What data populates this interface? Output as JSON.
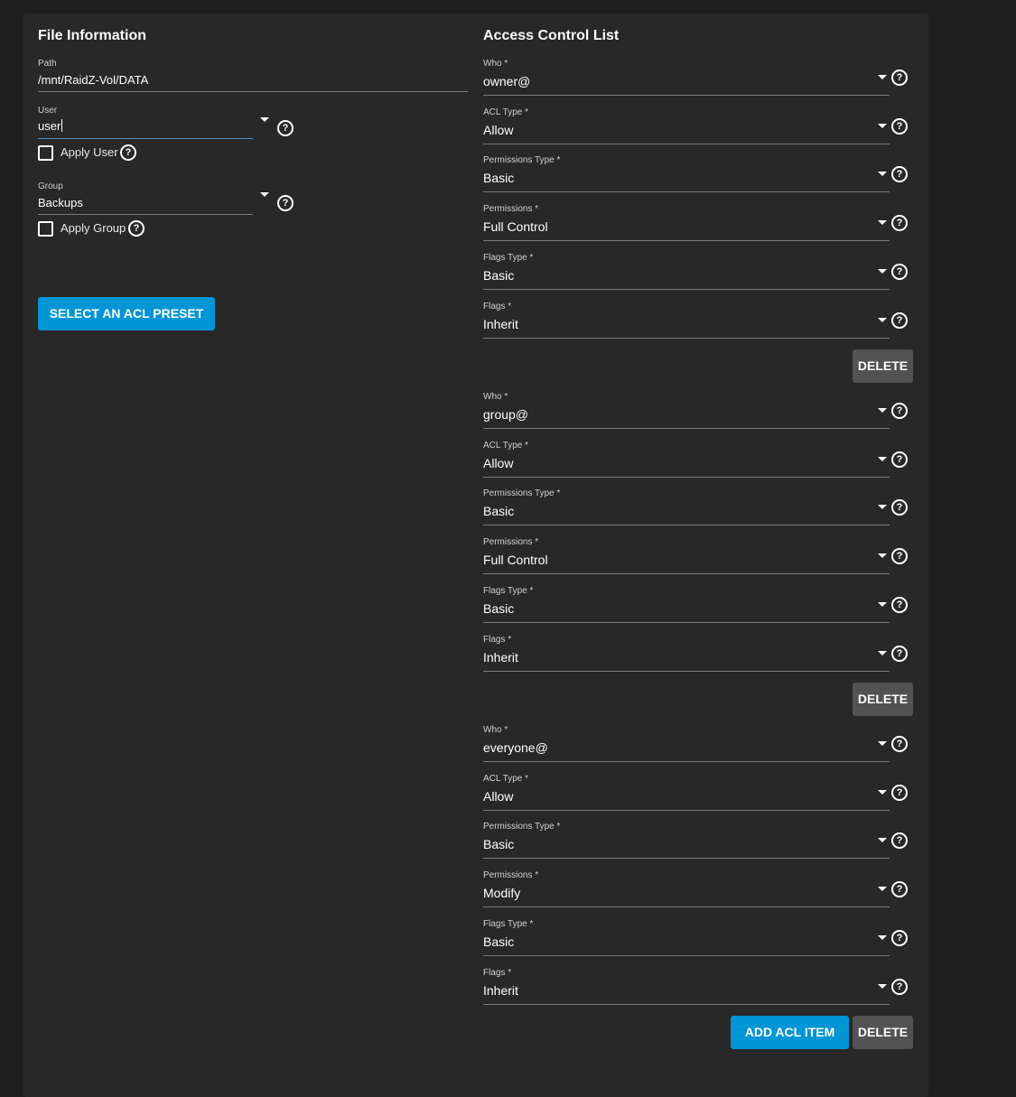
{
  "file_info": {
    "title": "File Information",
    "path_label": "Path",
    "path_value": "/mnt/RaidZ-Vol/DATA",
    "user_label": "User",
    "user_value": "user",
    "apply_user_label": "Apply User",
    "group_label": "Group",
    "group_value": "Backups",
    "apply_group_label": "Apply Group",
    "preset_button": "SELECT AN ACL PRESET"
  },
  "acl": {
    "title": "Access Control List",
    "field_labels": {
      "who": "Who *",
      "acl_type": "ACL Type *",
      "permissions_type": "Permissions Type *",
      "permissions": "Permissions *",
      "flags_type": "Flags Type *",
      "flags": "Flags *"
    },
    "items": [
      {
        "who": "owner@",
        "acl_type": "Allow",
        "permissions_type": "Basic",
        "permissions": "Full Control",
        "flags_type": "Basic",
        "flags": "Inherit"
      },
      {
        "who": "group@",
        "acl_type": "Allow",
        "permissions_type": "Basic",
        "permissions": "Full Control",
        "flags_type": "Basic",
        "flags": "Inherit"
      },
      {
        "who": "everyone@",
        "acl_type": "Allow",
        "permissions_type": "Basic",
        "permissions": "Modify",
        "flags_type": "Basic",
        "flags": "Inherit"
      }
    ],
    "delete_button": "DELETE",
    "add_button": "ADD ACL ITEM"
  },
  "icons": {
    "help": "help-circle-icon",
    "dropdown": "caret-down-icon",
    "checkbox": "checkbox-unchecked-icon"
  },
  "colors": {
    "background": "#1e1e1e",
    "card": "#282828",
    "primary": "#0095d5",
    "secondary_button": "#525252"
  }
}
